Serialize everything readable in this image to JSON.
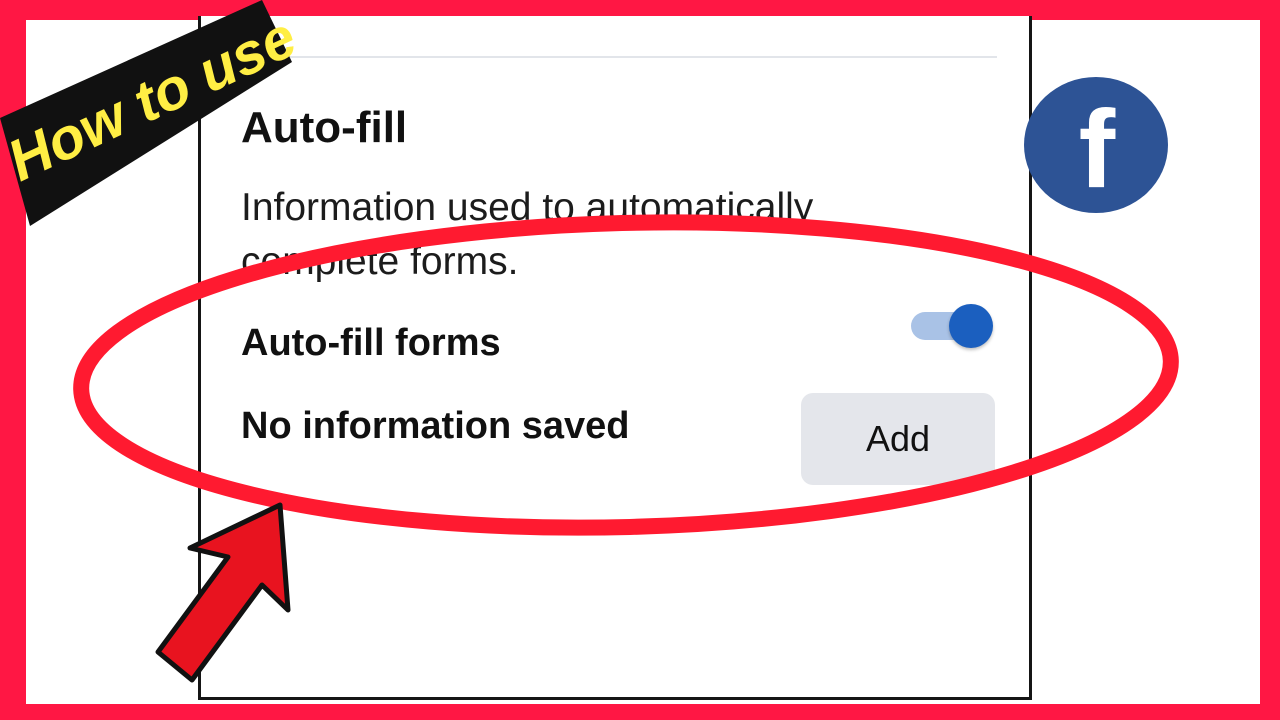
{
  "badge": {
    "text": "How to use",
    "text_color": "#ffee44",
    "background": "#111111"
  },
  "settings": {
    "section_title": "Auto-fill",
    "description": "Information used to automatically complete forms.",
    "autofill_forms": {
      "label": "Auto-fill forms",
      "enabled": true
    },
    "saved_info": {
      "label": "No information saved",
      "add_label": "Add"
    }
  },
  "logo": {
    "glyph": "f",
    "brand": "facebook-icon",
    "color": "#2d5395"
  },
  "colors": {
    "frame": "#ff1744",
    "highlight": "#ff1a30",
    "toggle_knob": "#1b5fbf",
    "toggle_track": "#a9c2e6",
    "button_bg": "#e4e6eb"
  }
}
